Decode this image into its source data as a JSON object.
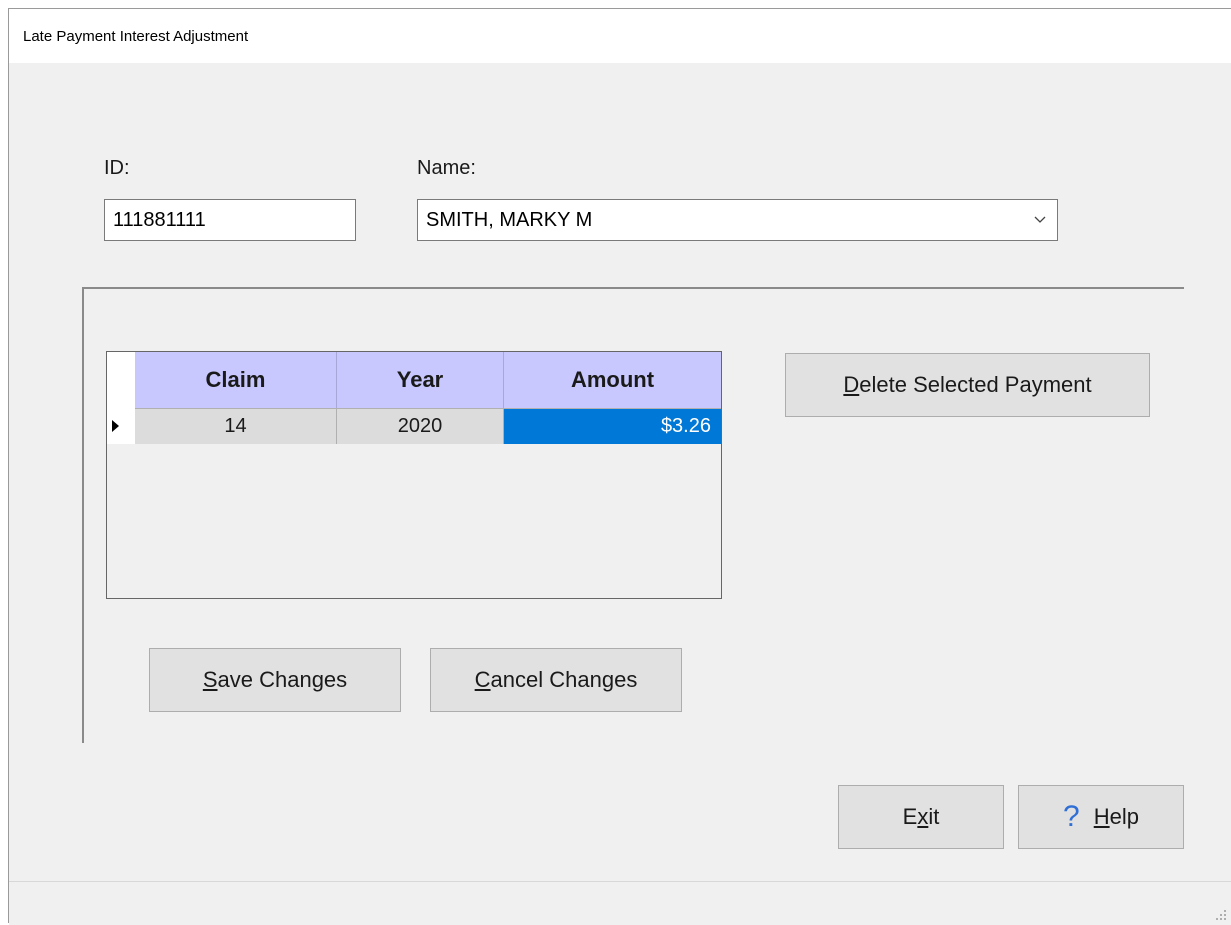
{
  "window": {
    "title": "Late Payment Interest Adjustment"
  },
  "form": {
    "id_label": "ID:",
    "id_value": "111881111",
    "name_label": "Name:",
    "name_value": "SMITH, MARKY M"
  },
  "grid": {
    "columns": [
      "Claim",
      "Year",
      "Amount"
    ],
    "rows": [
      {
        "claim": "14",
        "year": "2020",
        "amount": "$3.26"
      }
    ],
    "selected_color": "#0078d7",
    "header_color": "#c8c8ff"
  },
  "buttons": {
    "delete_payment": {
      "prefix": "",
      "underline": "D",
      "rest": "elete Selected Payment"
    },
    "save_changes": {
      "prefix": "",
      "underline": "S",
      "rest": "ave Changes"
    },
    "cancel_changes": {
      "prefix": "",
      "underline": "C",
      "rest": "ancel Changes"
    },
    "exit": {
      "prefix": "E",
      "underline": "x",
      "rest": "it"
    },
    "help": {
      "icon": "question-mark-icon",
      "prefix": "",
      "underline": "H",
      "rest": "elp"
    }
  }
}
